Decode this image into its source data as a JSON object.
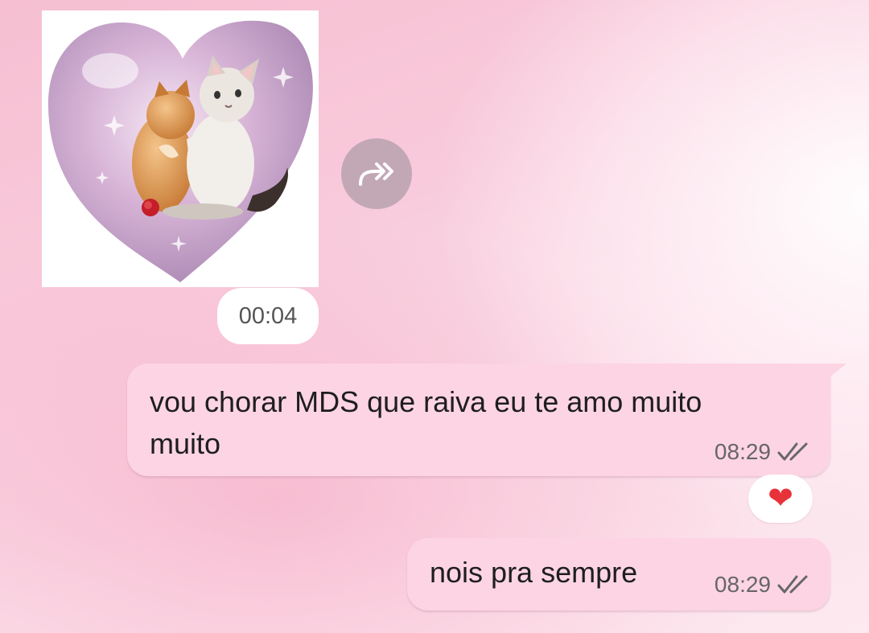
{
  "media_message": {
    "duration": "00:04",
    "forward_icon": "forward-icon"
  },
  "messages": [
    {
      "text": "vou chorar MDS que raiva eu te amo muito muito",
      "time": "08:29",
      "status_icon": "double-check-icon"
    },
    {
      "text": "nois pra sempre",
      "time": "08:29",
      "status_icon": "double-check-icon"
    }
  ],
  "reaction": {
    "emoji": "❤",
    "icon": "heart-reaction-icon"
  },
  "colors": {
    "bubble": "#fdd4e4",
    "accent_heart": "#e8323a"
  }
}
